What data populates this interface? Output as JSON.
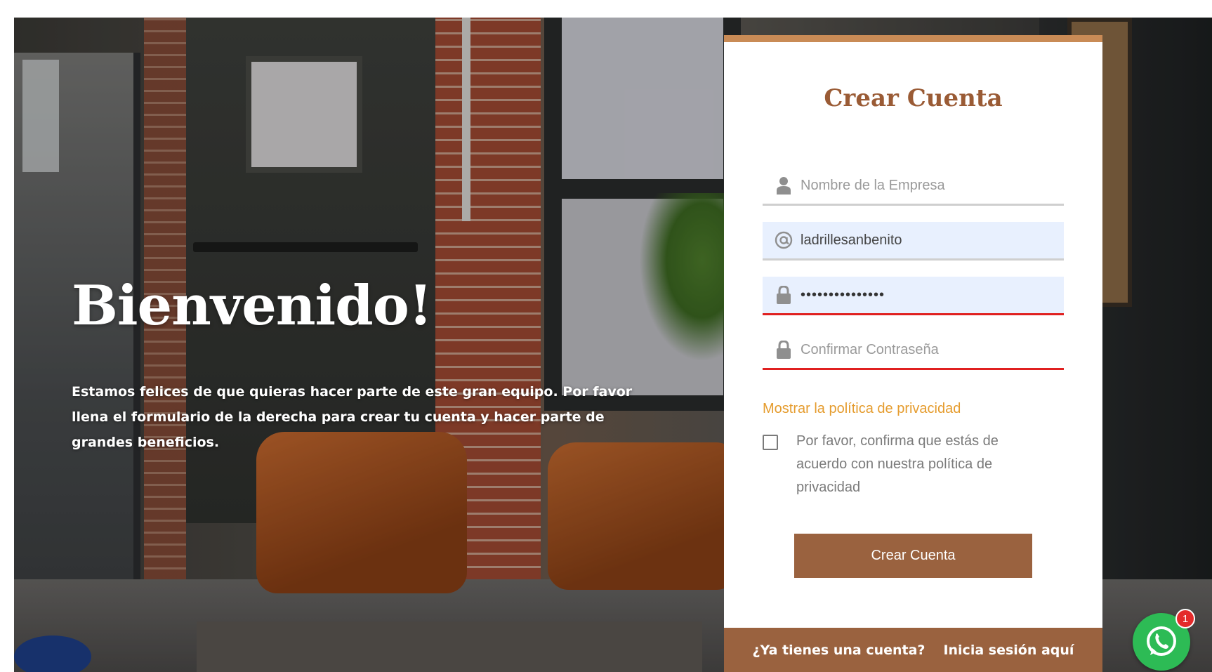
{
  "welcome": {
    "title": "Bienvenido!",
    "text": "Estamos felices de que quieras hacer parte de este gran equipo. Por favor llena el formulario de la derecha para crear tu cuenta y hacer parte de grandes beneficios."
  },
  "form": {
    "title": "Crear Cuenta",
    "company": {
      "placeholder": "Nombre de la Empresa",
      "value": ""
    },
    "username": {
      "placeholder": "",
      "value": "ladrillesanbenito"
    },
    "password": {
      "masked_value": "•••••••••••••••"
    },
    "confirm_password": {
      "placeholder": "Confirmar Contraseña",
      "value": ""
    },
    "privacy_link": "Mostrar la política de privacidad",
    "privacy_checkbox_label": "Por favor, confirma que estás de acuerdo con nuestra política de privacidad",
    "submit_label": "Crear Cuenta"
  },
  "footer": {
    "question": "¿Ya tienes una cuenta?",
    "login_link": "Inicia sesión aquí"
  },
  "whatsapp": {
    "badge_count": "1"
  },
  "icons": {
    "company": "user-icon",
    "username": "at-icon",
    "password": "lock-icon",
    "confirm": "lock-icon",
    "chat": "whatsapp-icon"
  },
  "colors": {
    "accent": "#9a623f",
    "title": "#9a5b35",
    "link": "#e59c2e",
    "error": "#e02020",
    "autofill": "#e8f0fe",
    "whatsapp": "#2dbb55",
    "badge": "#e42b2b"
  }
}
